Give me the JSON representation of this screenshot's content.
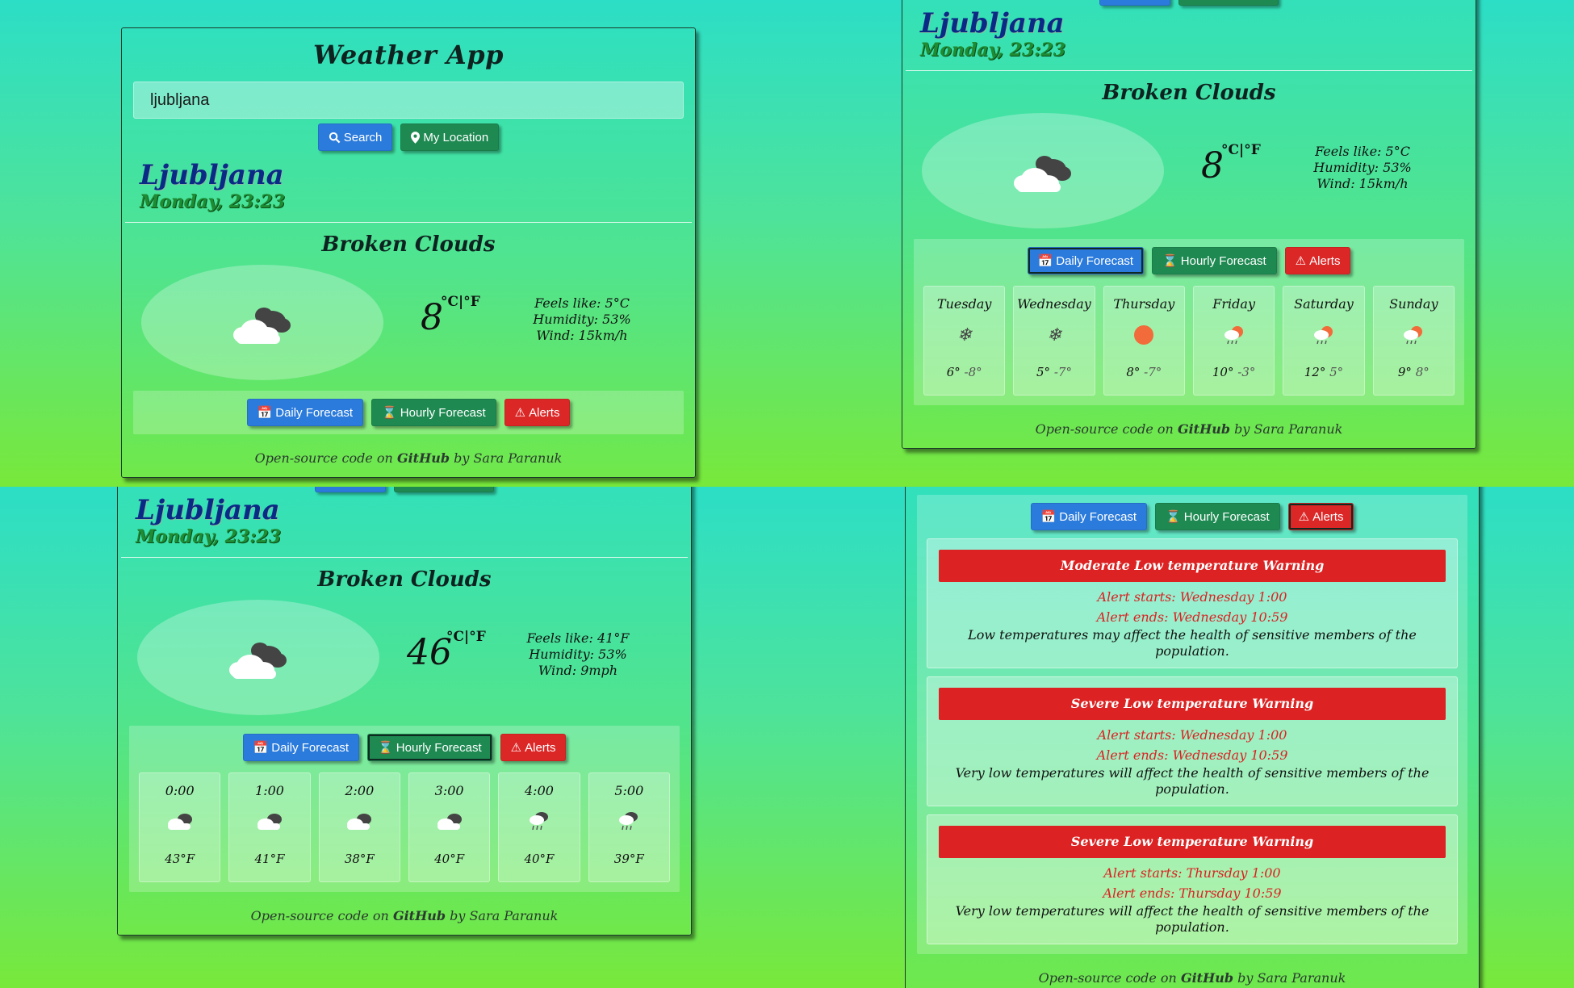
{
  "app": {
    "title": "Weather App",
    "search_value": "ljubljana",
    "search_label": "Search",
    "location_label": "My Location",
    "city": "Ljubljana",
    "date": "Monday, 23:23",
    "condition": "Broken Clouds",
    "tabs": {
      "daily": "Daily Forecast",
      "hourly": "Hourly Forecast",
      "alerts": "Alerts"
    },
    "footer": {
      "prefix": "Open-source code on ",
      "link": "GitHub",
      "suffix": " by Sara Paranuk"
    },
    "unit_toggle": "°C|°F"
  },
  "metric": {
    "temp": "8",
    "feels": "Feels like: 5°C",
    "humidity": "Humidity: 53%",
    "wind": "Wind: 15km/h"
  },
  "imperial": {
    "temp": "46",
    "feels": "Feels like: 41°F",
    "humidity": "Humidity: 53%",
    "wind": "Wind: 9mph"
  },
  "daily": [
    {
      "day": "Tuesday",
      "icon": "snowflake-icon",
      "hi": "6°",
      "lo": "-8°"
    },
    {
      "day": "Wednesday",
      "icon": "snowflake-icon",
      "hi": "5°",
      "lo": "-7°"
    },
    {
      "day": "Thursday",
      "icon": "sun-icon",
      "hi": "8°",
      "lo": "-7°"
    },
    {
      "day": "Friday",
      "icon": "sun-rain-cloud-icon",
      "hi": "10°",
      "lo": "-3°"
    },
    {
      "day": "Saturday",
      "icon": "sun-rain-cloud-icon",
      "hi": "12°",
      "lo": "5°"
    },
    {
      "day": "Sunday",
      "icon": "sun-rain-cloud-icon",
      "hi": "9°",
      "lo": "8°"
    }
  ],
  "hourly": [
    {
      "time": "0:00",
      "icon": "broken-clouds-icon",
      "temp": "43°F"
    },
    {
      "time": "1:00",
      "icon": "broken-clouds-icon",
      "temp": "41°F"
    },
    {
      "time": "2:00",
      "icon": "broken-clouds-icon",
      "temp": "38°F"
    },
    {
      "time": "3:00",
      "icon": "broken-clouds-icon",
      "temp": "40°F"
    },
    {
      "time": "4:00",
      "icon": "rain-cloud-icon",
      "temp": "40°F"
    },
    {
      "time": "5:00",
      "icon": "rain-cloud-icon",
      "temp": "39°F"
    }
  ],
  "alerts": [
    {
      "title": "Moderate Low temperature Warning",
      "starts": "Alert starts: Wednesday 1:00",
      "ends": "Alert ends: Wednesday 10:59",
      "desc": "Low temperatures may affect the health of sensitive members of the population."
    },
    {
      "title": "Severe Low temperature Warning",
      "starts": "Alert starts: Wednesday 1:00",
      "ends": "Alert ends: Wednesday 10:59",
      "desc": "Very low temperatures will affect the health of sensitive members of the population."
    },
    {
      "title": "Severe Low temperature Warning",
      "starts": "Alert starts: Thursday 1:00",
      "ends": "Alert ends: Thursday 10:59",
      "desc": "Very low temperatures will affect the health of sensitive members of the population."
    }
  ],
  "colors": {
    "blue": "#2b7bdc",
    "green": "#1e8a52",
    "red": "#dc2727",
    "city": "#0b2a86",
    "date": "#1f8b33"
  }
}
